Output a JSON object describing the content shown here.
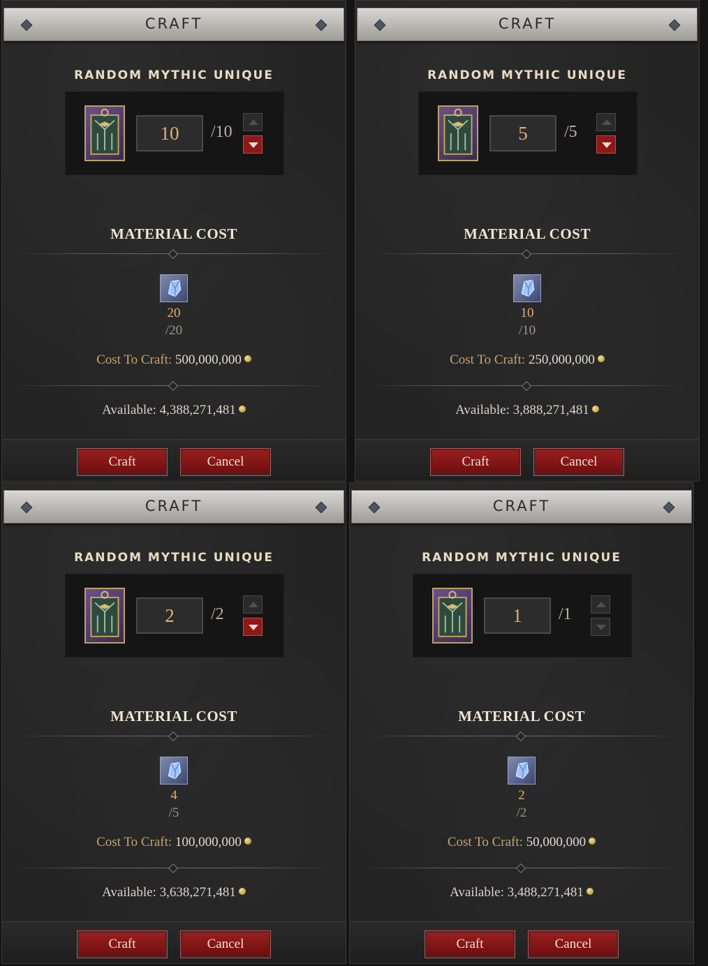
{
  "panels": [
    {
      "title": "CRAFT",
      "item_name": "RANDOM MYTHIC UNIQUE",
      "quantity": "10",
      "quantity_max": "/10",
      "down_active": true,
      "material_header": "MATERIAL COST",
      "material_have": "20",
      "material_need": "/20",
      "cost_label": "Cost To Craft:",
      "cost_value": "500,000,000",
      "available_label": "Available:",
      "available_value": "4,388,271,481",
      "craft_label": "Craft",
      "cancel_label": "Cancel"
    },
    {
      "title": "CRAFT",
      "item_name": "RANDOM MYTHIC UNIQUE",
      "quantity": "5",
      "quantity_max": "/5",
      "down_active": true,
      "material_header": "MATERIAL COST",
      "material_have": "10",
      "material_need": "/10",
      "cost_label": "Cost To Craft:",
      "cost_value": "250,000,000",
      "available_label": "Available:",
      "available_value": "3,888,271,481",
      "craft_label": "Craft",
      "cancel_label": "Cancel"
    },
    {
      "title": "CRAFT",
      "item_name": "RANDOM MYTHIC UNIQUE",
      "quantity": "2",
      "quantity_max": "/2",
      "down_active": true,
      "material_header": "MATERIAL COST",
      "material_have": "4",
      "material_need": "/5",
      "cost_label": "Cost To Craft:",
      "cost_value": "100,000,000",
      "available_label": "Available:",
      "available_value": "3,638,271,481",
      "craft_label": "Craft",
      "cancel_label": "Cancel"
    },
    {
      "title": "CRAFT",
      "item_name": "RANDOM MYTHIC UNIQUE",
      "quantity": "1",
      "quantity_max": "/1",
      "down_active": false,
      "material_header": "MATERIAL COST",
      "material_have": "2",
      "material_need": "/2",
      "cost_label": "Cost To Craft:",
      "cost_value": "50,000,000",
      "available_label": "Available:",
      "available_value": "3,488,271,481",
      "craft_label": "Craft",
      "cancel_label": "Cancel"
    }
  ],
  "icons": {
    "item": "mythic-cache-icon",
    "material": "resplendent-spark-icon",
    "currency": "gold-coin-icon",
    "increase": "arrow-up-icon",
    "decrease": "arrow-down-icon"
  }
}
